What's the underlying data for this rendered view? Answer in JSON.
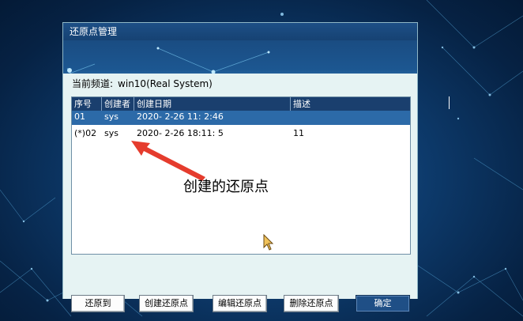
{
  "window": {
    "title": "还原点管理"
  },
  "channel": {
    "label": "当前频道:",
    "value": "win10(Real System)"
  },
  "table": {
    "columns": [
      "序号",
      "创建者",
      "创建日期",
      "描述"
    ],
    "rows": [
      {
        "index": "01",
        "creator": "sys",
        "date": "2020- 2-26 11: 2:46",
        "description": "",
        "selected": true
      },
      {
        "index": "(*)02",
        "creator": "sys",
        "date": "2020- 2-26 18:11: 5",
        "description": "11",
        "selected": false
      }
    ]
  },
  "annotation": {
    "text": "创建的还原点",
    "color": "#e53c2d"
  },
  "buttons": {
    "restore": "还原到",
    "create": "创建还原点",
    "edit": "编辑还原点",
    "delete": "删除还原点",
    "ok": "确定"
  },
  "colors": {
    "selected_row": "#2c6aa8",
    "header": "#1a3f6e",
    "primary_button": "#1f4f86"
  }
}
